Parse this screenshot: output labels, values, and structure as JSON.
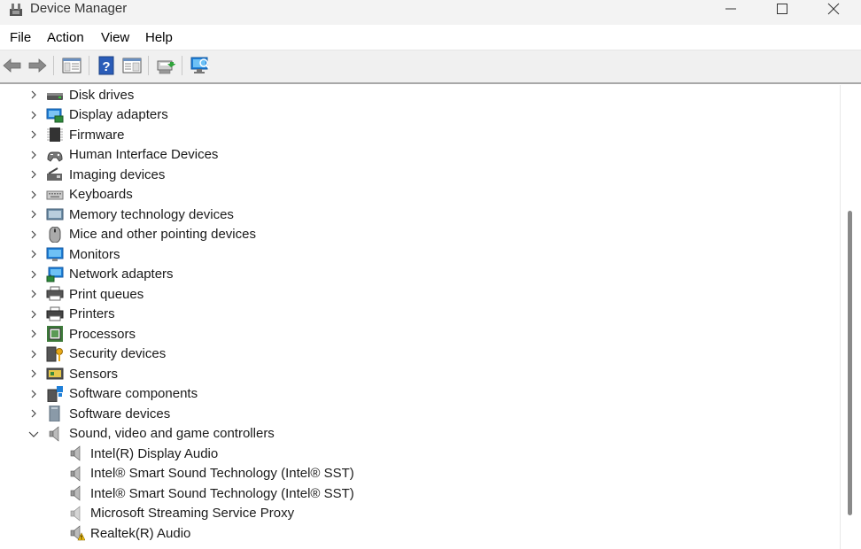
{
  "window": {
    "title": "Device Manager",
    "minimize_glyph": "—",
    "maximize_glyph": "☐",
    "close_glyph": "✕"
  },
  "menu": [
    "File",
    "Action",
    "View",
    "Help"
  ],
  "toolbar": {
    "icons": [
      "back-arrow-icon",
      "forward-arrow-icon",
      "show-hide-console-tree-icon",
      "help-icon",
      "properties-icon",
      "update-driver-icon",
      "scan-hardware-icon"
    ]
  },
  "tree": {
    "categories": [
      {
        "label": "Disk drives",
        "icon": "disk-drive-icon",
        "expanded": false
      },
      {
        "label": "Display adapters",
        "icon": "display-adapter-icon",
        "expanded": false
      },
      {
        "label": "Firmware",
        "icon": "firmware-icon",
        "expanded": false
      },
      {
        "label": "Human Interface Devices",
        "icon": "hid-icon",
        "expanded": false
      },
      {
        "label": "Imaging devices",
        "icon": "camera-icon",
        "expanded": false
      },
      {
        "label": "Keyboards",
        "icon": "keyboard-icon",
        "expanded": false
      },
      {
        "label": "Memory technology devices",
        "icon": "memory-icon",
        "expanded": false
      },
      {
        "label": "Mice and other pointing devices",
        "icon": "mouse-icon",
        "expanded": false
      },
      {
        "label": "Monitors",
        "icon": "monitor-icon",
        "expanded": false
      },
      {
        "label": "Network adapters",
        "icon": "network-icon",
        "expanded": false
      },
      {
        "label": "Print queues",
        "icon": "print-queue-icon",
        "expanded": false
      },
      {
        "label": "Printers",
        "icon": "printer-icon",
        "expanded": false
      },
      {
        "label": "Processors",
        "icon": "processor-icon",
        "expanded": false
      },
      {
        "label": "Security devices",
        "icon": "security-icon",
        "expanded": false
      },
      {
        "label": "Sensors",
        "icon": "sensor-icon",
        "expanded": false
      },
      {
        "label": "Software components",
        "icon": "software-component-icon",
        "expanded": false
      },
      {
        "label": "Software devices",
        "icon": "software-device-icon",
        "expanded": false
      },
      {
        "label": "Sound, video and game controllers",
        "icon": "speaker-icon",
        "expanded": true
      }
    ],
    "sound_children": [
      {
        "label": "Intel(R) Display Audio",
        "icon": "speaker-icon",
        "warning": false
      },
      {
        "label": "Intel® Smart Sound Technology (Intel® SST)",
        "icon": "speaker-icon",
        "warning": false
      },
      {
        "label": "Intel® Smart Sound Technology (Intel® SST)",
        "icon": "speaker-icon",
        "warning": false
      },
      {
        "label": "Microsoft Streaming Service Proxy",
        "icon": "speaker-icon",
        "warning": false
      },
      {
        "label": "Realtek(R) Audio",
        "icon": "speaker-warning-icon",
        "warning": true
      }
    ]
  },
  "colors": {
    "accent_blue": "#1e7fd8",
    "warning_yellow": "#f4c20d",
    "toolbar_bg": "#f0f0f0"
  }
}
